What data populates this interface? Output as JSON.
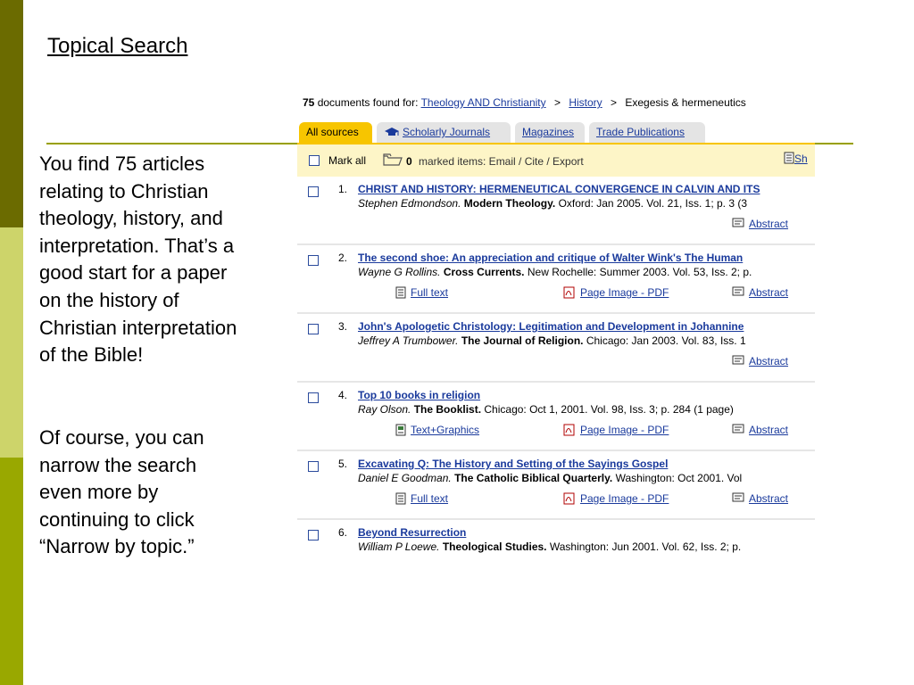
{
  "slide": {
    "title": "Topical Search",
    "paragraph1": "You find 75 articles relating to Christian theology, history, and interpretation. That’s a good start for a paper on the history of Christian interpretation of the Bible!",
    "paragraph2": "Of course, you can narrow the search even more by continuing to click “Narrow by topic.”"
  },
  "breadcrumb": {
    "count": "75",
    "found_text": "documents found for:",
    "query": "Theology AND Christianity",
    "sep1": ">",
    "topic": "History",
    "sep2": ">",
    "subtopic": "Exegesis & hermeneutics"
  },
  "tabs": [
    {
      "label": "All sources",
      "active": true
    },
    {
      "label": "Scholarly Journals",
      "icon": "graduation-cap-icon"
    },
    {
      "label": "Magazines"
    },
    {
      "label": "Trade Publications"
    }
  ],
  "toolbar": {
    "mark_all": "Mark all",
    "marked_count": "0",
    "marked_text": "marked items: Email / Cite / Export",
    "show_label": "Sh"
  },
  "results": [
    {
      "num": "1.",
      "title": "CHRIST AND HISTORY: HERMENEUTICAL CONVERGENCE IN CALVIN AND ITS",
      "author": "Stephen Edmondson.",
      "journal": "Modern Theology.",
      "details": "Oxford: Jan 2005. Vol. 21, Iss. 1; p. 3 (3",
      "links": {
        "abstract": "Abstract"
      }
    },
    {
      "num": "2.",
      "title": "The second shoe: An appreciation and critique of Walter Wink's The Human",
      "author": "Wayne G Rollins.",
      "journal": "Cross Currents.",
      "details": "New Rochelle: Summer 2003. Vol. 53, Iss. 2; p.",
      "links": {
        "text": "Full text",
        "pdf": "Page Image - PDF",
        "abstract": "Abstract"
      }
    },
    {
      "num": "3.",
      "title": "John's Apologetic Christology: Legitimation and Development in Johannine",
      "author": "Jeffrey A Trumbower.",
      "journal": "The Journal of Religion.",
      "details": "Chicago: Jan 2003. Vol. 83, Iss. 1",
      "links": {
        "abstract": "Abstract"
      }
    },
    {
      "num": "4.",
      "title": "Top 10 books in religion",
      "author": "Ray Olson.",
      "journal": "The Booklist.",
      "details": "Chicago: Oct 1, 2001. Vol. 98, Iss. 3; p. 284 (1 page)",
      "links": {
        "text": "Text+Graphics",
        "pdf": "Page Image - PDF",
        "abstract": "Abstract"
      }
    },
    {
      "num": "5.",
      "title": "Excavating Q: The History and Setting of the Sayings Gospel",
      "author": "Daniel E Goodman.",
      "journal": "The Catholic Biblical Quarterly.",
      "details": "Washington: Oct 2001. Vol",
      "links": {
        "text": "Full text",
        "pdf": "Page Image - PDF",
        "abstract": "Abstract"
      }
    },
    {
      "num": "6.",
      "title": "Beyond Resurrection",
      "author": "William P Loewe.",
      "journal": "Theological Studies.",
      "details": "Washington: Jun 2001. Vol. 62, Iss. 2; p.",
      "links": {}
    }
  ],
  "colors": {
    "accent_tab": "#f7c500",
    "link": "#1a3a9c",
    "stripe_dark": "#6b6b00",
    "stripe_light": "#cdd46a",
    "stripe_mid": "#99a800",
    "rule": "#99a000"
  }
}
